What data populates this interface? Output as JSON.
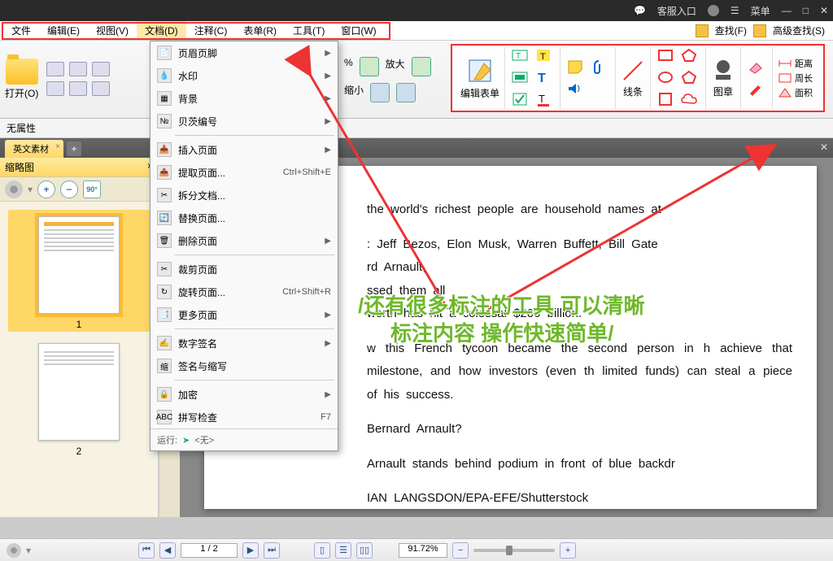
{
  "titlebar": {
    "service": "客服入口",
    "menu": "菜单",
    "min": "—",
    "max": "□",
    "close": "✕"
  },
  "menubar": {
    "items": [
      {
        "label": "文件"
      },
      {
        "label": "编辑(E)"
      },
      {
        "label": "视图(V)"
      },
      {
        "label": "文档(D)"
      },
      {
        "label": "注释(C)"
      },
      {
        "label": "表单(R)"
      },
      {
        "label": "工具(T)"
      },
      {
        "label": "窗口(W)"
      }
    ],
    "find": "查找(F)",
    "advfind": "高级查找(S)"
  },
  "ribbon": {
    "open": "打开(O)",
    "zoom_in": "放大",
    "zoom_out": "缩小",
    "pct": "%",
    "tools": {
      "edit_form": "编辑表单",
      "lines": "线条",
      "stamp": "图章",
      "distance": "距离",
      "perimeter": "周长",
      "area": "面积"
    }
  },
  "noselect": "无属性",
  "tab": {
    "name": "英文素材"
  },
  "sidepanel": {
    "title": "缩略图",
    "close": "×",
    "page1": "1",
    "page2": "2"
  },
  "dropdown": {
    "items": [
      {
        "icon": "📄",
        "label": "页眉页脚",
        "arrow": true
      },
      {
        "icon": "💧",
        "label": "水印",
        "arrow": true
      },
      {
        "icon": "▦",
        "label": "背景",
        "arrow": true
      },
      {
        "icon": "№",
        "label": "贝茨编号",
        "arrow": true
      },
      {
        "sep": true
      },
      {
        "icon": "📥",
        "label": "插入页面",
        "arrow": true
      },
      {
        "icon": "📤",
        "label": "提取页面...",
        "shortcut": "Ctrl+Shift+E"
      },
      {
        "icon": "✂",
        "label": "拆分文档..."
      },
      {
        "icon": "🔄",
        "label": "替换页面..."
      },
      {
        "icon": "🗑",
        "label": "删除页面",
        "arrow": true
      },
      {
        "sep": true
      },
      {
        "icon": "✂",
        "label": "裁剪页面"
      },
      {
        "icon": "↻",
        "label": "旋转页面...",
        "shortcut": "Ctrl+Shift+R"
      },
      {
        "icon": "📑",
        "label": "更多页面",
        "arrow": true
      },
      {
        "sep": true
      },
      {
        "icon": "✍",
        "label": "数字签名",
        "arrow": true
      },
      {
        "icon": "缩",
        "label": "签名与缩写"
      },
      {
        "sep": true
      },
      {
        "icon": "🔒",
        "label": "加密",
        "arrow": true
      },
      {
        "icon": "ABC",
        "label": "拼写检查",
        "shortcut": "F7"
      }
    ],
    "footer_label": "运行:",
    "footer_value": "<无>"
  },
  "document": {
    "p1": "the world's richest people are household names at",
    "p2_a": ": Jeff Bezos, Elon Musk, Warren Buffett, Bill Gate",
    "p2_b": "rd Arnault, ",
    "p2_c": "ssed them all ",
    "p2_d": " worth has hit a colossal $200 billion.",
    "p3": "w this French tycoon became the second person in h   achieve that milestone, and how investors (even th   limited funds) can steal a piece of his success.",
    "p4": "Bernard Arnault?",
    "p5": "Arnault stands behind podium in front of blue backdr",
    "p6": "IAN LANGSDON/EPA-EFE/Shutterstock"
  },
  "overlay": {
    "line1": "/还有很多标注的工具 可以清晰",
    "line2": "标注内容 操作快速简单/"
  },
  "statusbar": {
    "page": "1 / 2",
    "zoom": "91.72%"
  }
}
